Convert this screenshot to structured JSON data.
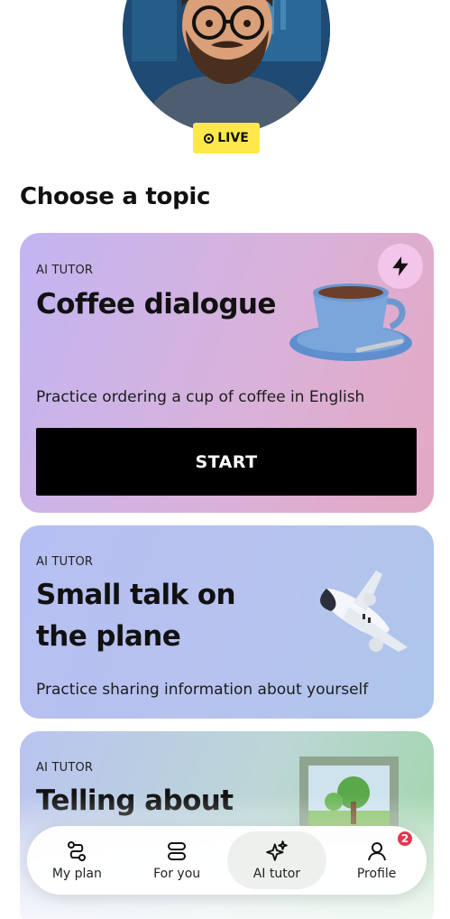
{
  "live_badge": {
    "label": "LIVE"
  },
  "section_title": "Choose a topic",
  "cards": [
    {
      "kicker": "AI TUTOR",
      "title": "Coffee dialogue",
      "description": "Practice ordering a cup of coffee in English",
      "button_label": "START",
      "icon": "bolt-icon",
      "illustration": "coffee-cup"
    },
    {
      "kicker": "AI TUTOR",
      "title": "Small talk on the plane",
      "description": "Practice sharing information about yourself",
      "illustration": "airplane"
    },
    {
      "kicker": "AI TUTOR",
      "title": "Telling about",
      "illustration": "picture-frame"
    }
  ],
  "bottom_nav": {
    "items": [
      {
        "label": "My plan",
        "icon": "route-icon"
      },
      {
        "label": "For you",
        "icon": "cards-icon"
      },
      {
        "label": "AI tutor",
        "icon": "sparkles-icon",
        "active": true
      },
      {
        "label": "Profile",
        "icon": "person-icon",
        "badge": "2"
      }
    ]
  },
  "colors": {
    "live_badge": "#ffe94a",
    "start_button": "#000000",
    "badge": "#e8344e",
    "card1_gradient_end": "#e3a8c2"
  }
}
